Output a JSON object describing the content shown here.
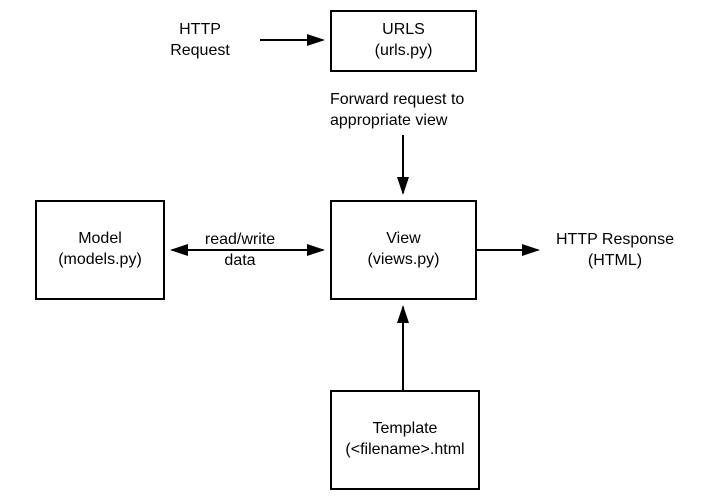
{
  "httpRequest": {
    "line1": "HTTP",
    "line2": "Request"
  },
  "urls": {
    "line1": "URLS",
    "line2": "(urls.py)"
  },
  "forward": {
    "line1": "Forward request to",
    "line2": "appropriate view"
  },
  "model": {
    "line1": "Model",
    "line2": "(models.py)"
  },
  "readwrite": {
    "line1": "read/write",
    "line2": "data"
  },
  "view": {
    "line1": "View",
    "line2": "(views.py)"
  },
  "httpResponse": {
    "line1": "HTTP Response",
    "line2": "(HTML)"
  },
  "template": {
    "line1": "Template",
    "line2": "(<filename>.html"
  }
}
